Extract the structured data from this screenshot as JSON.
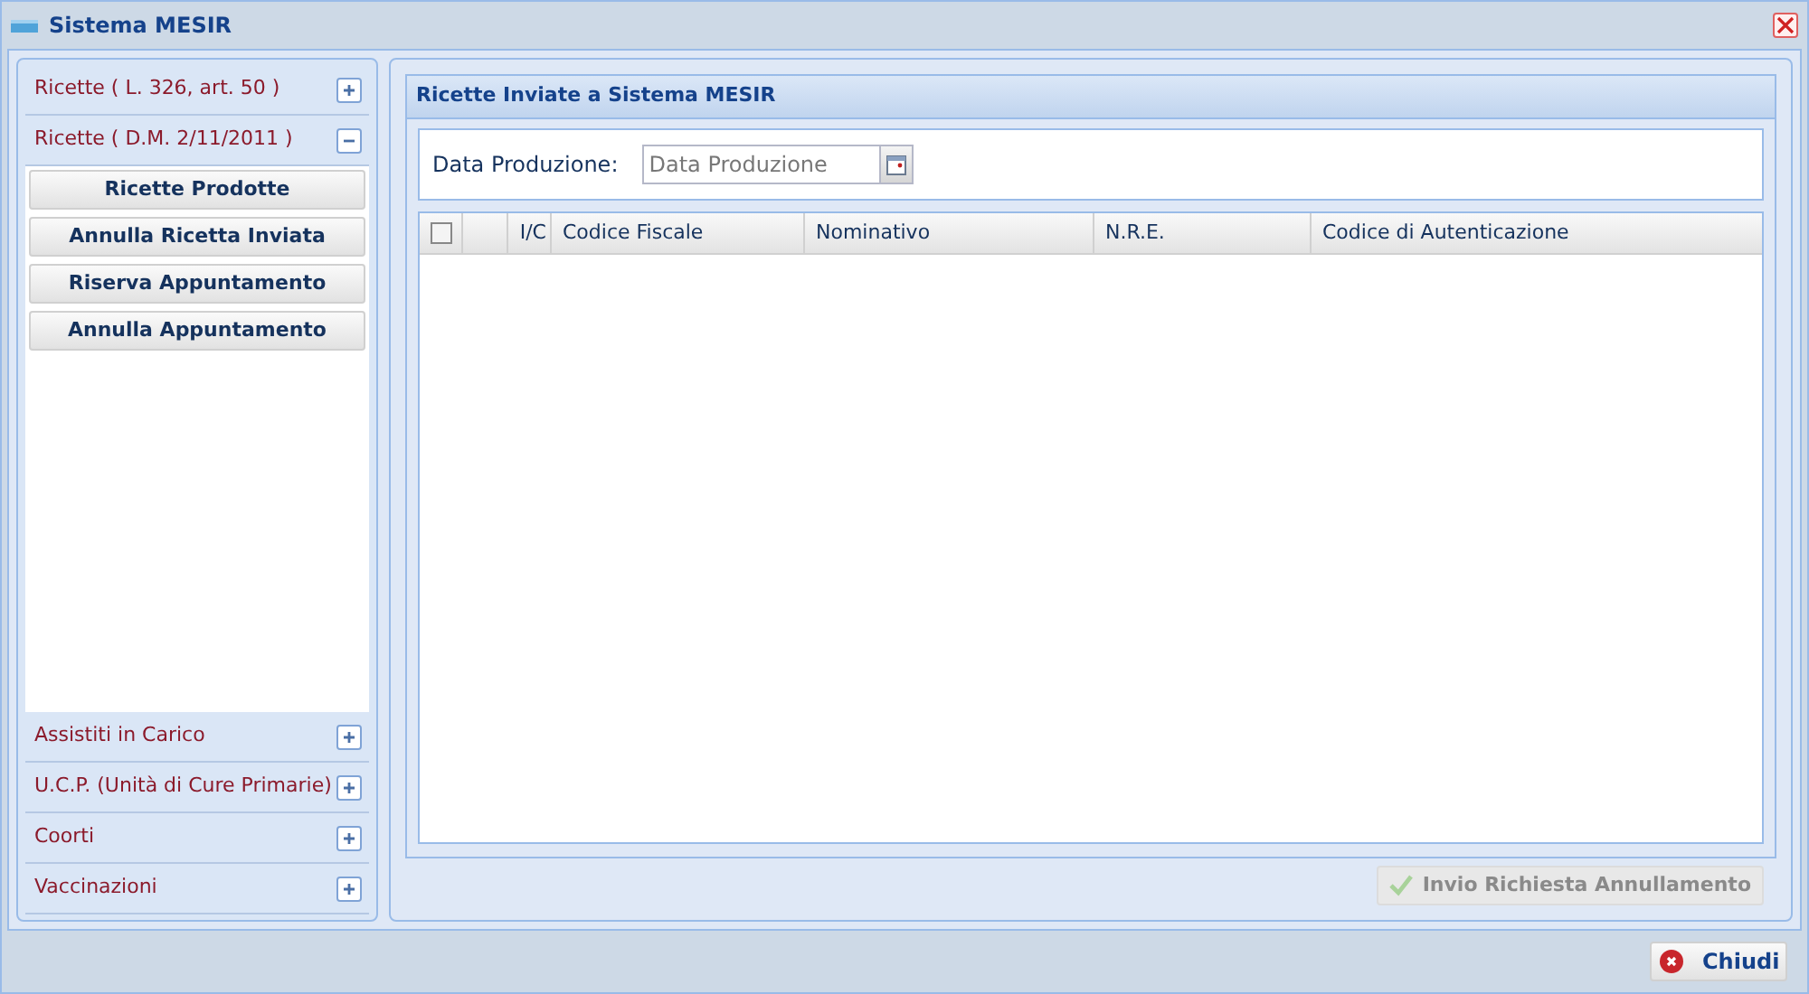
{
  "window": {
    "title": "Sistema MESIR"
  },
  "sidebar": {
    "sections": [
      {
        "label": "Ricette ( L. 326, art. 50 )",
        "expanded": false
      },
      {
        "label": "Ricette ( D.M. 2/11/2011 )",
        "expanded": true,
        "items": [
          "Ricette Prodotte",
          "Annulla Ricetta Inviata",
          "Riserva Appuntamento",
          "Annulla Appuntamento"
        ]
      },
      {
        "label": "Assistiti in Carico",
        "expanded": false
      },
      {
        "label": "U.C.P. (Unità di Cure Primarie)",
        "expanded": false
      },
      {
        "label": "Coorti",
        "expanded": false
      },
      {
        "label": "Vaccinazioni",
        "expanded": false
      }
    ]
  },
  "panel": {
    "title": "Ricette Inviate a Sistema MESIR",
    "date_field": {
      "label": "Data Produzione:",
      "placeholder": "Data Produzione"
    },
    "table": {
      "select_all_checked": false,
      "columns": [
        "I/C",
        "Codice Fiscale",
        "Nominativo",
        "N.R.E.",
        "Codice di Autenticazione"
      ]
    },
    "submit": {
      "label": "Invio Richiesta Annullamento",
      "disabled": true
    }
  },
  "footer": {
    "close_button": "Chiudi"
  }
}
